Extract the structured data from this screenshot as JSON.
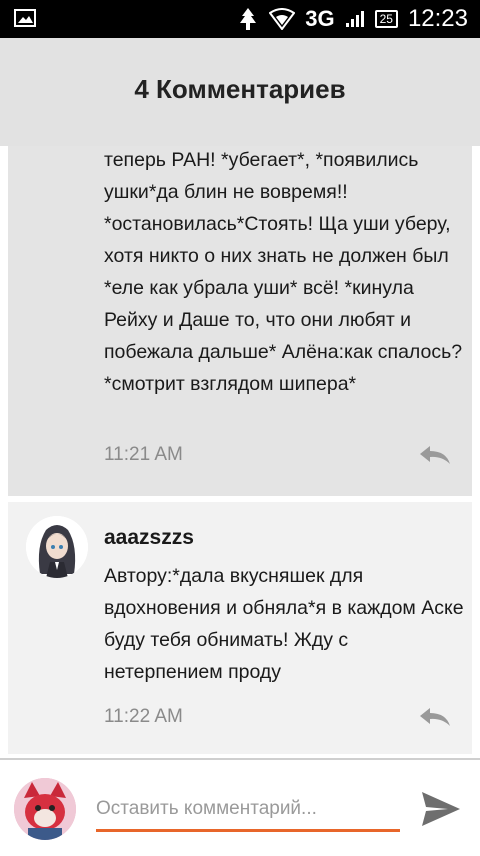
{
  "status_bar": {
    "network": "3G",
    "battery": "25",
    "time": "12:23"
  },
  "header": {
    "title": "4 Комментариев"
  },
  "comments": [
    {
      "text": "теперь РАН! *убегает*, *появились ушки*да блин не вовремя!! *остановилась*Стоять! Ща уши уберу, хотя никто о них знать не должен был *еле как убрала уши* всё! *кинула Рейху и Даше то, что они любят и побежала дальше* Алёна:как спалось? *смотрит взглядом шипера*",
      "time": "11:21 AM"
    },
    {
      "author": "aaazszzs",
      "text": "Автору:*дала вкусняшек для вдохновения и обняла*я в каждом Аске буду тебя обнимать! Жду с нетерпением проду",
      "time": "11:22 AM"
    }
  ],
  "composer": {
    "placeholder": "Оставить комментарий..."
  },
  "colors": {
    "accent": "#e8662a",
    "status_bar": "#000000",
    "header_bg": "#e2e2e2"
  }
}
